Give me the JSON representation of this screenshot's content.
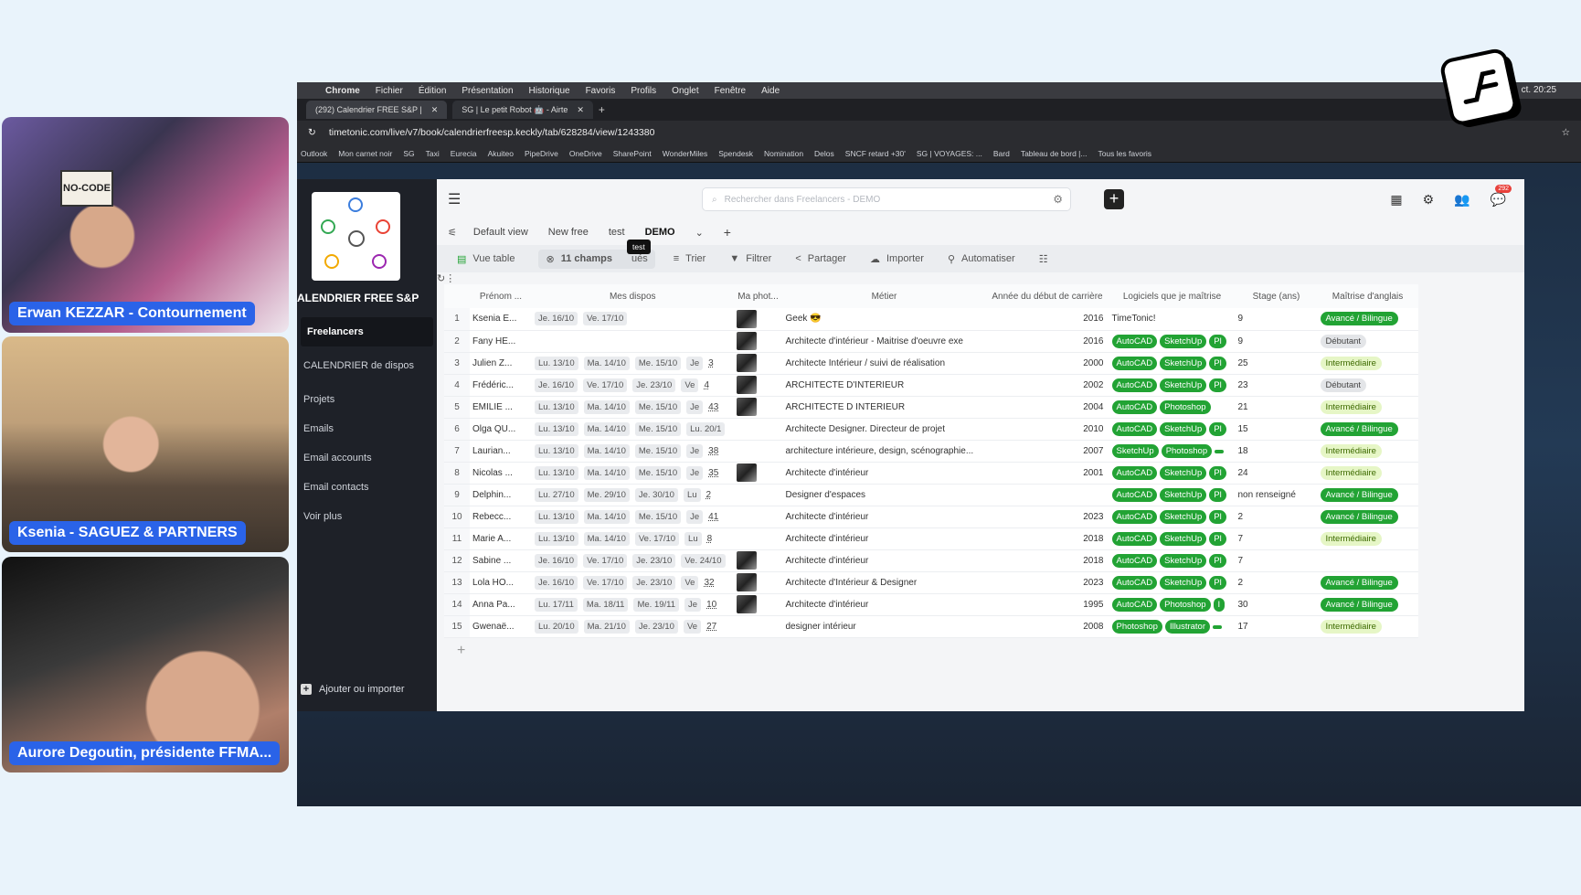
{
  "participants": [
    {
      "name": "Erwan KEZZAR - Contournement",
      "sign": "NO-CODE"
    },
    {
      "name": "Ksenia - SAGUEZ & PARTNERS"
    },
    {
      "name": "Aurore Degoutin, présidente FFMA..."
    }
  ],
  "menubar": {
    "app": "Chrome",
    "items": [
      "Fichier",
      "Édition",
      "Présentation",
      "Historique",
      "Favoris",
      "Profils",
      "Onglet",
      "Fenêtre",
      "Aide"
    ],
    "clock": "ct. 20:25"
  },
  "tabs": [
    {
      "label": "(292) Calendrier FREE S&P |"
    },
    {
      "label": "SG | Le petit Robot 🤖 - Airte"
    }
  ],
  "address": "timetonic.com/live/v7/book/calendrierfreesp.keckly/tab/628284/view/1243380",
  "bookmarks": [
    "Outlook",
    "Mon carnet noir",
    "SG",
    "Taxi",
    "Eurecia",
    "Akuiteo",
    "PipeDrive",
    "OneDrive",
    "SharePoint",
    "WonderMiles",
    "Spendesk",
    "Nomination",
    "Delos",
    "SNCF retard +30'",
    "SG | VOYAGES: ...",
    "Bard",
    "Tableau de bord |...",
    "Tous les favoris"
  ],
  "sidebar": {
    "org": "ALENDRIER FREE S&P",
    "items": [
      "Freelancers",
      "CALENDRIER de dispos",
      "Projets",
      "Emails",
      "Email accounts",
      "Email contacts",
      "Voir plus"
    ],
    "add_label": "Ajouter ou importer"
  },
  "search": {
    "placeholder": "Rechercher dans Freelancers - DEMO"
  },
  "notif_count": "292",
  "views": [
    "Default view",
    "New free",
    "test",
    "DEMO"
  ],
  "tooltip": "test",
  "toolbar": {
    "table": "Vue table",
    "fields": "11 champs",
    "fields_suffix": "ués",
    "sort": "Trier",
    "filter": "Filtrer",
    "share": "Partager",
    "import": "Importer",
    "automate": "Automatiser"
  },
  "columns": [
    "Prénom ...",
    "Mes dispos",
    "Ma phot...",
    "Métier",
    "Année du début de carrière",
    "Logiciels que je maîtrise",
    "Stage (ans)",
    "Maîtrise d'anglais"
  ],
  "rows": [
    {
      "n": "1",
      "name": "Ksenia E...",
      "dispos": [
        "Je. 16/10",
        "Ve. 17/10"
      ],
      "cnt": "",
      "photo": true,
      "metier": "Geek 😎",
      "year": "2016",
      "soft": [],
      "soft_text": "TimeTonic!",
      "stage": "9",
      "eng": "Avancé / Bilingue",
      "lvl": "adv"
    },
    {
      "n": "2",
      "name": "Fany HE...",
      "dispos": [],
      "cnt": "",
      "photo": true,
      "metier": "Architecte d'intérieur - Maitrise d'oeuvre exe",
      "year": "2016",
      "soft": [
        "AutoCAD",
        "SketchUp",
        "Pl"
      ],
      "soft_text": "",
      "stage": "9",
      "eng": "Débutant",
      "lvl": "deb"
    },
    {
      "n": "3",
      "name": "Julien Z...",
      "dispos": [
        "Lu. 13/10",
        "Ma. 14/10",
        "Me. 15/10",
        "Je"
      ],
      "cnt": "3",
      "photo": true,
      "metier": "Architecte Intérieur / suivi de réalisation",
      "year": "2000",
      "soft": [
        "AutoCAD",
        "SketchUp",
        "Pl"
      ],
      "soft_text": "",
      "stage": "25",
      "eng": "Intermédiaire",
      "lvl": "int"
    },
    {
      "n": "4",
      "name": "Frédéric...",
      "dispos": [
        "Je. 16/10",
        "Ve. 17/10",
        "Je. 23/10",
        "Ve"
      ],
      "cnt": "4",
      "photo": true,
      "metier": "ARCHITECTE D'INTERIEUR",
      "year": "2002",
      "soft": [
        "AutoCAD",
        "SketchUp",
        "Pl"
      ],
      "soft_text": "",
      "stage": "23",
      "eng": "Débutant",
      "lvl": "deb"
    },
    {
      "n": "5",
      "name": "EMILIE ...",
      "dispos": [
        "Lu. 13/10",
        "Ma. 14/10",
        "Me. 15/10",
        "Je"
      ],
      "cnt": "43",
      "photo": true,
      "metier": "ARCHITECTE D INTERIEUR",
      "year": "2004",
      "soft": [
        "AutoCAD",
        "Photoshop"
      ],
      "soft_text": "",
      "stage": "21",
      "eng": "Intermédiaire",
      "lvl": "int"
    },
    {
      "n": "6",
      "name": "Olga QU...",
      "dispos": [
        "Lu. 13/10",
        "Ma. 14/10",
        "Me. 15/10",
        "Lu. 20/1"
      ],
      "cnt": "",
      "photo": false,
      "metier": "Architecte Designer. Directeur de projet",
      "year": "2010",
      "soft": [
        "AutoCAD",
        "SketchUp",
        "Pl"
      ],
      "soft_text": "",
      "stage": "15",
      "eng": "Avancé / Bilingue",
      "lvl": "adv"
    },
    {
      "n": "7",
      "name": "Laurian...",
      "dispos": [
        "Lu. 13/10",
        "Ma. 14/10",
        "Me. 15/10",
        "Je"
      ],
      "cnt": "38",
      "photo": false,
      "metier": "architecture intérieure, design, scénographie...",
      "year": "2007",
      "soft": [
        "SketchUp",
        "Photoshop",
        ""
      ],
      "soft_text": "",
      "stage": "18",
      "eng": "Intermédiaire",
      "lvl": "int"
    },
    {
      "n": "8",
      "name": "Nicolas ...",
      "dispos": [
        "Lu. 13/10",
        "Ma. 14/10",
        "Me. 15/10",
        "Je"
      ],
      "cnt": "35",
      "photo": true,
      "metier": "Architecte d'intérieur",
      "year": "2001",
      "soft": [
        "AutoCAD",
        "SketchUp",
        "Pl"
      ],
      "soft_text": "",
      "stage": "24",
      "eng": "Intermédiaire",
      "lvl": "int"
    },
    {
      "n": "9",
      "name": "Delphin...",
      "dispos": [
        "Lu. 27/10",
        "Me. 29/10",
        "Je. 30/10",
        "Lu"
      ],
      "cnt": "2",
      "photo": false,
      "metier": "Designer d'espaces",
      "year": "",
      "soft": [
        "AutoCAD",
        "SketchUp",
        "Pl"
      ],
      "soft_text": "",
      "stage": "non renseigné",
      "eng": "Avancé / Bilingue",
      "lvl": "adv"
    },
    {
      "n": "10",
      "name": "Rebecc...",
      "dispos": [
        "Lu. 13/10",
        "Ma. 14/10",
        "Me. 15/10",
        "Je"
      ],
      "cnt": "41",
      "photo": false,
      "metier": "Architecte d'intérieur",
      "year": "2023",
      "soft": [
        "AutoCAD",
        "SketchUp",
        "Pl"
      ],
      "soft_text": "",
      "stage": "2",
      "eng": "Avancé / Bilingue",
      "lvl": "adv"
    },
    {
      "n": "11",
      "name": "Marie A...",
      "dispos": [
        "Lu. 13/10",
        "Ma. 14/10",
        "Ve. 17/10",
        "Lu"
      ],
      "cnt": "8",
      "photo": false,
      "metier": "Architecte d'intérieur",
      "year": "2018",
      "soft": [
        "AutoCAD",
        "SketchUp",
        "Pl"
      ],
      "soft_text": "",
      "stage": "7",
      "eng": "Intermédiaire",
      "lvl": "int"
    },
    {
      "n": "12",
      "name": "Sabine ...",
      "dispos": [
        "Je. 16/10",
        "Ve. 17/10",
        "Je. 23/10",
        "Ve. 24/10"
      ],
      "cnt": "",
      "photo": true,
      "metier": "Architecte d'intérieur",
      "year": "2018",
      "soft": [
        "AutoCAD",
        "SketchUp",
        "Pl"
      ],
      "soft_text": "",
      "stage": "7",
      "eng": "",
      "lvl": ""
    },
    {
      "n": "13",
      "name": "Lola HO...",
      "dispos": [
        "Je. 16/10",
        "Ve. 17/10",
        "Je. 23/10",
        "Ve"
      ],
      "cnt": "32",
      "photo": true,
      "metier": "Architecte d'Intérieur & Designer",
      "year": "2023",
      "soft": [
        "AutoCAD",
        "SketchUp",
        "Pl"
      ],
      "soft_text": "",
      "stage": "2",
      "eng": "Avancé / Bilingue",
      "lvl": "adv"
    },
    {
      "n": "14",
      "name": "Anna Pa...",
      "dispos": [
        "Lu. 17/11",
        "Ma. 18/11",
        "Me. 19/11",
        "Je"
      ],
      "cnt": "10",
      "photo": true,
      "metier": "Architecte d'intérieur",
      "year": "1995",
      "soft": [
        "AutoCAD",
        "Photoshop",
        "I"
      ],
      "soft_text": "",
      "stage": "30",
      "eng": "Avancé / Bilingue",
      "lvl": "adv"
    },
    {
      "n": "15",
      "name": "Gwenaë...",
      "dispos": [
        "Lu. 20/10",
        "Ma. 21/10",
        "Je. 23/10",
        "Ve"
      ],
      "cnt": "27",
      "photo": false,
      "metier": "designer intérieur",
      "year": "2008",
      "soft": [
        "Photoshop",
        "Illustrator",
        ""
      ],
      "soft_text": "",
      "stage": "17",
      "eng": "Intermédiaire",
      "lvl": "int"
    }
  ],
  "colors": {
    "accent_green": "#22a334",
    "badge_blue": "#2a63e8",
    "sidebar": "#1e2128"
  }
}
